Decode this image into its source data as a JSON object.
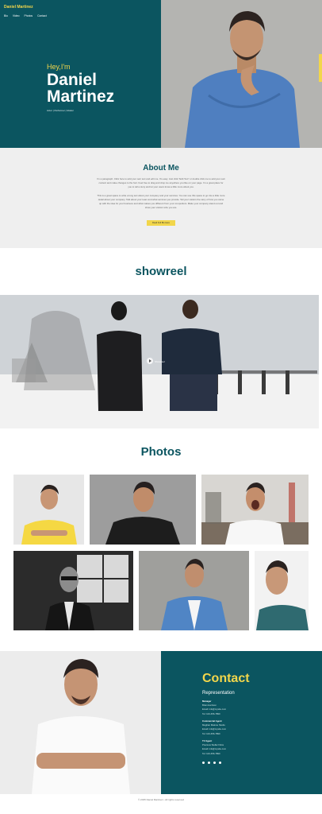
{
  "header": {
    "brand": "Daniel Martinez",
    "nav": [
      "Bio",
      "Video",
      "Photos",
      "Contact"
    ]
  },
  "hero": {
    "greeting": "Hey,I'm",
    "name": "Daniel Martinez",
    "roles": "Actor | Performer | Model"
  },
  "about": {
    "title": "About Me",
    "paragraph1": "I'm a paragraph. Click here to add your own text and edit me. It's easy. Just click \"Edit Text\" or double click me to add your own content and make changes to the font. Feel free to drag and drop me anywhere you like on your page. I'm a great place for you to tell a story and let your users know a little more about you.",
    "paragraph2": "This is a great space to write a long text about your company and your services. You can use this space to go into a little more detail about your company. Talk about your team and what services you provide. Tell your visitors the story of how you came up with the idea for your business and what makes you different from your competitors. Make your company stand out and show your visitors who you are.",
    "button": "Read Full Bio Here"
  },
  "showreel": {
    "title": "showreel",
    "play_label": "Showreel"
  },
  "photos": {
    "title": "Photos"
  },
  "contact": {
    "title": "Contact",
    "representation": "Representation",
    "agents": [
      {
        "role": "Manager",
        "name": "Brian Harrison",
        "email": "Email: info@mysite.com",
        "tel": "Tel: 123-456-7890"
      },
      {
        "role": "Commercial Agent",
        "name": "Meghan Malone Studio",
        "email": "Email: info@mysite.com",
        "tel": "Tel: 123-456-7890"
      },
      {
        "role": "TV Agent",
        "name": "Precious Stellar Films",
        "email": "Email: info@mysite.com",
        "tel": "Tel: 123-456-7890"
      }
    ]
  },
  "footer": {
    "text": "© 2035 Daniel Martinez • All rights reserved"
  },
  "colors": {
    "teal": "#0b5560",
    "yellow": "#f2d64b",
    "light_gray": "#efefef"
  }
}
